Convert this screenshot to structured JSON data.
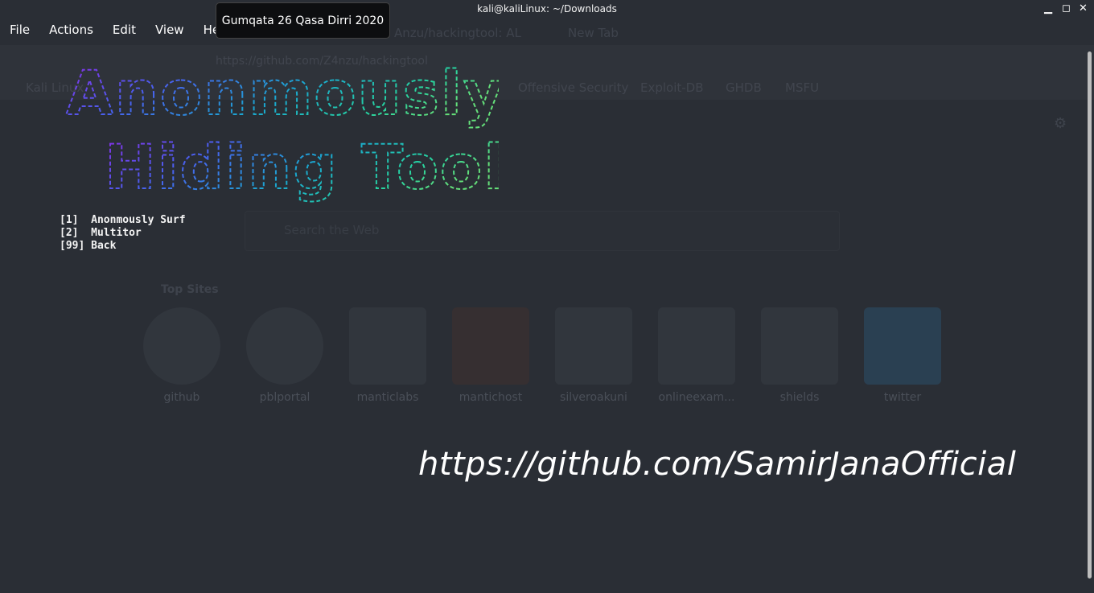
{
  "window": {
    "title": "kali@kaliLinux: ~/Downloads",
    "controls": [
      "▁",
      "◻",
      "✕"
    ]
  },
  "menubar": [
    "File",
    "Actions",
    "Edit",
    "View",
    "Help"
  ],
  "tooltip": "Gumqata 26 Qasa Dirri 2020",
  "background_browser": {
    "tabs": [
      "Anzu/hackingtool: AL",
      "New Tab"
    ],
    "url": "https://github.com/Z4nzu/hackingtool",
    "bookmarks": [
      "Kali Linux",
      "Offensive Security",
      "Exploit-DB",
      "GHDB",
      "MSFU"
    ],
    "search_placeholder": "Search the Web",
    "top_sites_heading": "Top Sites",
    "top_sites": [
      "github",
      "pblportal",
      "manticlabs",
      "mantichost",
      "silveroakuni",
      "onlineexam...",
      "shields",
      "twitter"
    ]
  },
  "banner": {
    "line1": "Anonmously",
    "line2": "Hiding Tool",
    "gradient": [
      "#8a2be2",
      "#4a5ff0",
      "#1aa7d0",
      "#26d3a0",
      "#64e07a"
    ]
  },
  "menu_options": [
    {
      "key": "[1]",
      "label": "Anonmously Surf"
    },
    {
      "key": "[2]",
      "label": "Multitor"
    },
    {
      "key": "[99]",
      "label": "Back"
    }
  ],
  "footer_link": "https://github.com/SamirJanaOfficial"
}
